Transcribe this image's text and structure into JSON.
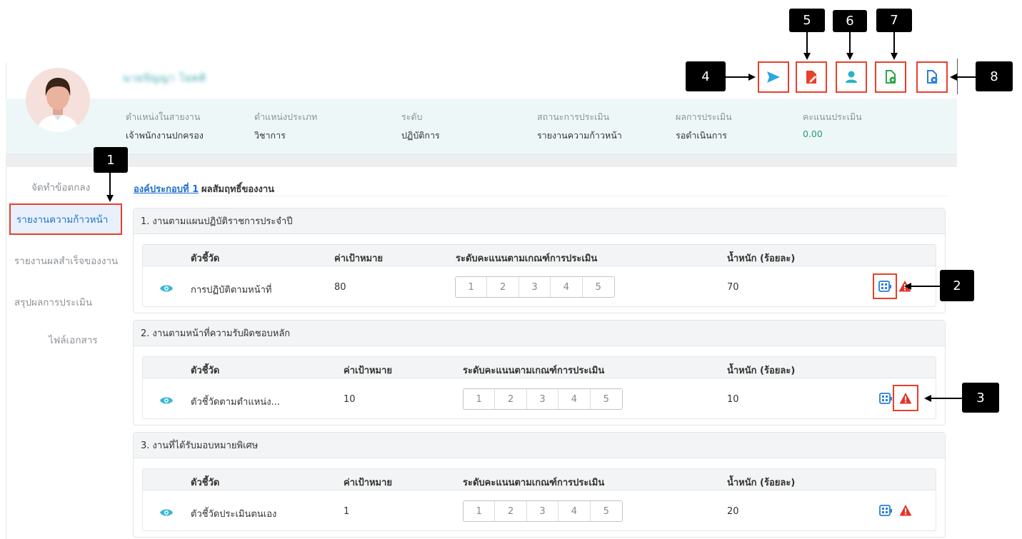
{
  "profile": {
    "name": "นายปัญญา โยคติ",
    "fields": [
      {
        "label": "ตำแหน่งในสายงาน",
        "value": "เจ้าพนักงานปกครอง"
      },
      {
        "label": "ตำแหน่งประเภท",
        "value": "วิชาการ"
      },
      {
        "label": "ระดับ",
        "value": "ปฏิบัติการ"
      },
      {
        "label": "สถานะการประเมิน",
        "value": "รายงานความก้าวหน้า"
      },
      {
        "label": "ผลการประเมิน",
        "value": "รอดำเนินการ"
      },
      {
        "label": "คะแนนประเมิน",
        "value": "0.00"
      }
    ]
  },
  "toolbar": [
    {
      "icon": "send-icon",
      "color": "#2aa8e0"
    },
    {
      "icon": "file-edit-icon",
      "color": "#e8402b"
    },
    {
      "icon": "user-icon",
      "color": "#2bb3c0"
    },
    {
      "icon": "file-view-icon",
      "color": "#28a745"
    },
    {
      "icon": "file-view-icon",
      "color": "#2a7fd4"
    }
  ],
  "callouts": [
    "1",
    "2",
    "3",
    "4",
    "5",
    "6",
    "7",
    "8"
  ],
  "sidebar": {
    "items": [
      {
        "label": "จัดทำข้อตกลง"
      },
      {
        "label": "รายงานความก้าวหน้า",
        "active": true
      },
      {
        "label": "รายงานผลสำเร็จของงาน"
      },
      {
        "label": "สรุปผลการประเมิน"
      },
      {
        "label": "ไฟล์เอกสาร"
      }
    ]
  },
  "component": {
    "link": "องค์ประกอบที่ 1",
    "title": "ผลสัมฤทธิ์ของงาน"
  },
  "table_headers": {
    "indicator": "ตัวชี้วัด",
    "target": "ค่าเป้าหมาย",
    "scale": "ระดับคะแนนตามเกณฑ์การประเมิน",
    "weight": "น้ำหนัก (ร้อยละ)"
  },
  "scale_levels": [
    "1",
    "2",
    "3",
    "4",
    "5"
  ],
  "sections": [
    {
      "title": "1. งานตามแผนปฏิบัติราชการประจำปี",
      "row": {
        "indicator": "การปฏิบัติตามหน้าที่",
        "target": "80",
        "weight": "70"
      }
    },
    {
      "title": "2. งานตามหน้าที่ความรับผิดชอบหลัก",
      "row": {
        "indicator": "ตัวชี้วัดตามตำแหน่ง...",
        "target": "10",
        "weight": "10"
      }
    },
    {
      "title": "3. งานที่ได้รับมอบหมายพิเศษ",
      "row": {
        "indicator": "ตัวชี้วัดประเมินตนเอง",
        "target": "1",
        "weight": "20"
      }
    }
  ],
  "colors": {
    "accent": "#1f6fd1",
    "highlight": "#e8402b",
    "eye": "#3bb4d8",
    "score": "#22a06b",
    "warning": "#e0362b"
  }
}
